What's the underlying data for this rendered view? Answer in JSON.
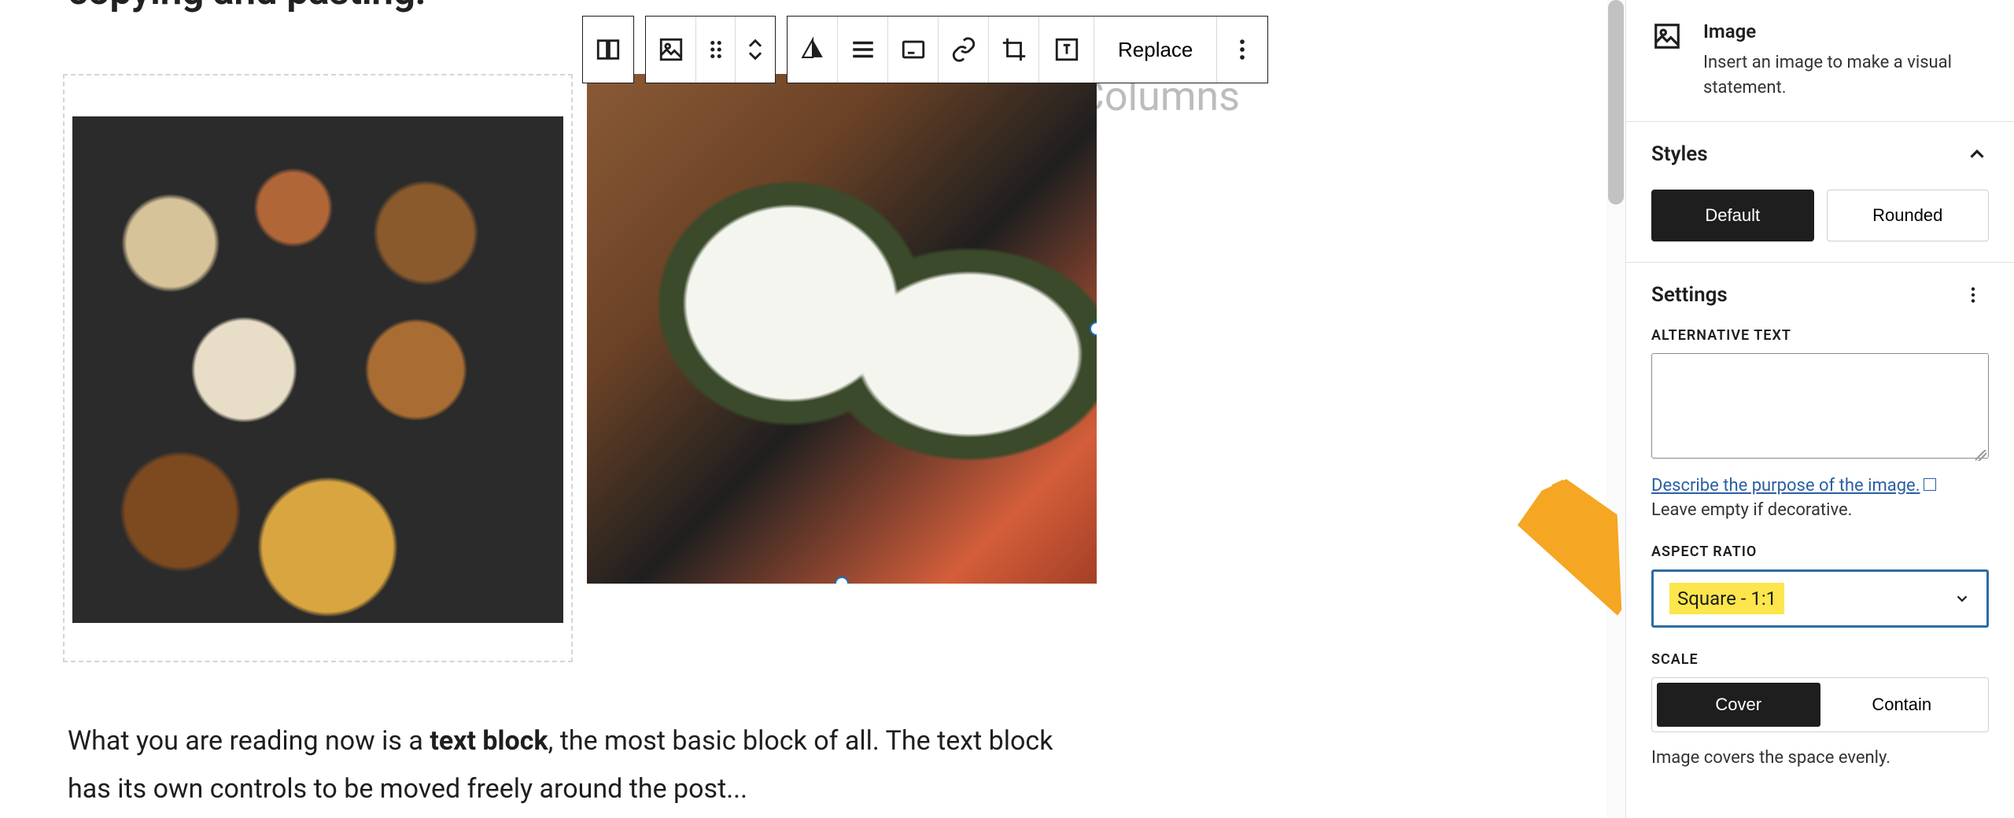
{
  "editor": {
    "heading_fragment": "copying and pasting.",
    "watermark": "Columns",
    "paragraph_before": "What you are reading now is a ",
    "paragraph_bold": "text block",
    "paragraph_after": ", the most basic block of all. The text block has its own controls to be moved freely around the post..."
  },
  "toolbar": {
    "replace": "Replace"
  },
  "sidebar": {
    "block_name": "Image",
    "block_desc": "Insert an image to make a visual statement.",
    "styles_title": "Styles",
    "style_default": "Default",
    "style_rounded": "Rounded",
    "settings_title": "Settings",
    "alt_label": "ALTERNATIVE TEXT",
    "alt_value": "",
    "alt_link": "Describe the purpose of the image.",
    "alt_helper": "Leave empty if decorative.",
    "aspect_label": "ASPECT RATIO",
    "aspect_value": "Square - 1:1",
    "scale_label": "SCALE",
    "scale_cover": "Cover",
    "scale_contain": "Contain",
    "scale_helper": "Image covers the space evenly."
  }
}
